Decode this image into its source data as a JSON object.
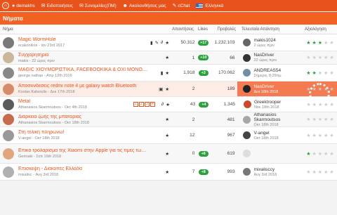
{
  "topbar": {
    "user": "demakhs",
    "nav": [
      {
        "icon": "envelope-icon",
        "label": "Ειδοποιήσεις"
      },
      {
        "icon": "chat-icon",
        "label": "Συνομιλίες(ΠΜ)"
      },
      {
        "icon": "users-icon",
        "label": "Ακολουθήσεις μας"
      },
      {
        "icon": "chat-bubble-icon",
        "label": "cChat"
      }
    ],
    "language": "Ελληνικά"
  },
  "section_title": "Νήματα",
  "headers": {
    "topic": "Νήμα",
    "replies": "Απαντήσεις",
    "likes": "Likes",
    "views": "Προβολές",
    "last": "Τελευταία Απάντηση",
    "rating": "Αξιολόγηση"
  },
  "rows": [
    {
      "title": "Magic WormHole",
      "sub": "ecakonikos - Ιαν 23rd 2017",
      "replies": "50.312",
      "likes": "+17",
      "views": "1.232.103",
      "last_name": "makis1024",
      "last_time": "2 ώρες πριν",
      "stars": 3
    },
    {
      "title": "Συγχαρητήρια",
      "sub": "makis - 22 ώρες πριν",
      "replies": "1",
      "likes": "+10",
      "views": "66",
      "last_name": "NasDriver",
      "last_time": "22 ώρες πριν",
      "stars": 0
    },
    {
      "title": "MAGIC ΧΙΟΥΜΟΡΙΣΤΙΚΑ, FACEBOOKIKA & OXI MONO....",
      "sub": "george.nathas - Απρ 12th 2016",
      "replies": "1.918",
      "likes": "+3",
      "views": "170.062",
      "last_name": "ANDREAS54",
      "last_time": "Σήμερα, 8:29πμ",
      "stars": 2
    },
    {
      "title": "Αποσυνδεσεις redmi note 4 με galaxy watch Bluetooth",
      "sub": "Kostas Katsoulis - Δεκ 17th 2018",
      "replies": "2",
      "likes": "",
      "views": "189",
      "last_name": "NasDriver",
      "last_time": "Δεκ 18th 2018",
      "stars": 0
    },
    {
      "title": "Metal",
      "sub": "Athanasios Skarmoutsos - Οκτ 4th 2018",
      "replies": "43",
      "likes": "+4",
      "views": "1.345",
      "last_name": "Greektrooper",
      "last_time": "Νοε 18th 2018",
      "stars": 0,
      "pages": [
        "1",
        "2",
        "3",
        "4"
      ]
    },
    {
      "title": "Διάρκεια ζωής της μπαταρίας",
      "sub": "Athanasios Skarmoutsos - Οκτ 18th 2018",
      "replies": "2",
      "likes": "",
      "views": "481",
      "last_name": "Athanasios Skarmoutsos",
      "last_time": "Οκτ 18th 2018",
      "stars": 0
    },
    {
      "title": "Στη τελική πληρώνω!",
      "sub": "V-angel - Οκτ 18th 2018",
      "replies": "12",
      "likes": "",
      "views": "967",
      "last_name": "V-angel",
      "last_time": "Οκτ 18th 2018",
      "stars": 0
    },
    {
      "title": "Επικο τρολαρισμα της Xiaomi στην Apple για τις τιμες των νεων Iphone",
      "sub": "Gerinaki - Σεπ 16th 2018",
      "replies": "0",
      "likes": "+6",
      "views": "619",
      "last_name": "",
      "last_time": "",
      "stars": 1
    },
    {
      "title": "Επισκεψη - Διακοπές Ελλάδα",
      "sub": "mixalisc - Αυγ 3rd 2018",
      "replies": "7",
      "likes": "+8",
      "views": "993",
      "last_name": "mixalisccy",
      "last_time": "Αυγ 3rd 2018",
      "stars": 0
    }
  ],
  "colors": {
    "accent": "#e8531c",
    "green": "#2aa13b",
    "highlight": "#f37a51"
  }
}
